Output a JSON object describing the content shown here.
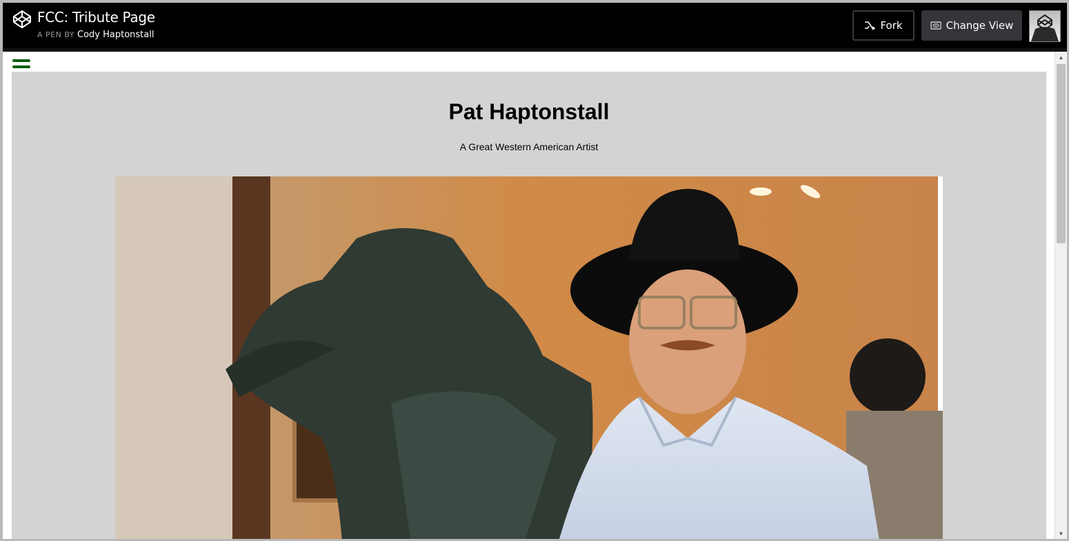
{
  "header": {
    "title": "FCC: Tribute Page",
    "byline_prefix": "A PEN BY",
    "author": "Cody Haptonstall",
    "logo_icon": "codepen-logo-icon",
    "fork_label": "Fork",
    "fork_icon": "fork-icon",
    "change_view_label": "Change View",
    "change_view_icon": "eye-icon",
    "avatar": "user-avatar"
  },
  "page": {
    "menu_icon": "hamburger-menu-icon",
    "title": "Pat Haptonstall",
    "subtitle": "A Great Western American Artist",
    "photo": "photo-of-man-in-cowboy-hat-beside-bronze-sculpture"
  },
  "colors": {
    "header_bg": "#000000",
    "panel_bg": "#d3d3d3",
    "menu_icon": "#0a5f0a",
    "change_view_bg": "#333539"
  }
}
